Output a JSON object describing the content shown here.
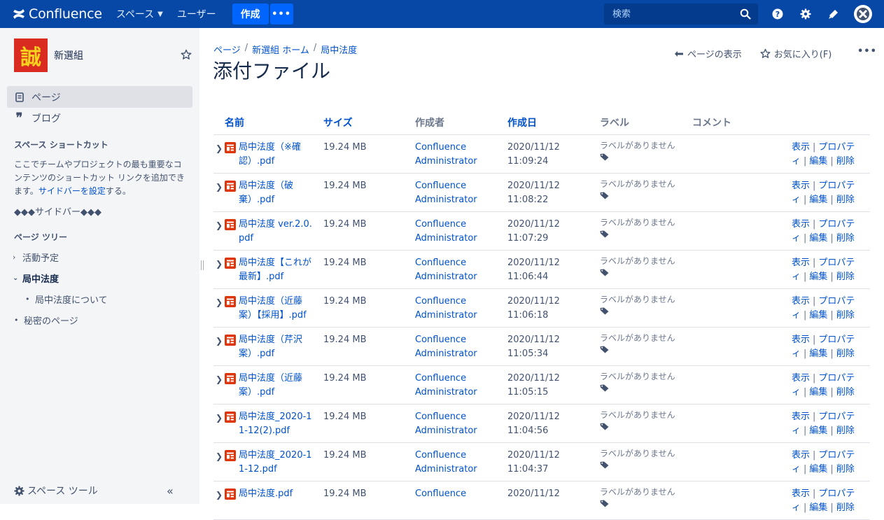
{
  "topnav": {
    "product": "Confluence",
    "spaces": "スペース",
    "users": "ユーザー",
    "create": "作成",
    "more": "•••",
    "search_placeholder": "検索"
  },
  "sidebar": {
    "space_logo_char": "誠",
    "space_name": "新選組",
    "nav": [
      {
        "label": "ページ"
      },
      {
        "label": "ブログ"
      }
    ],
    "shortcuts_heading": "スペース ショートカット",
    "shortcuts_text_before": "ここでチームやプロジェクトの最も重要なコンテンツのショートカット リンクを追加できます。",
    "shortcuts_link": "サイドバーを設定",
    "shortcuts_text_after": "する。",
    "custom_text": "◆◆◆サイドバー◆◆◆",
    "tree_heading": "ページ ツリー",
    "tree": [
      {
        "label": "活動予定"
      },
      {
        "label": "局中法度"
      },
      {
        "label": "局中法度について"
      },
      {
        "label": "秘密のページ"
      }
    ],
    "tools": "スペース ツール",
    "collapse": "«"
  },
  "breadcrumb": [
    "ページ",
    "新選組 ホーム",
    "局中法度"
  ],
  "page": {
    "title": "添付ファイル",
    "view_page": "ページの表示",
    "favourite": "お気に入り(F)",
    "more": "•••"
  },
  "table": {
    "headers": {
      "name": "名前",
      "size": "サイズ",
      "creator": "作成者",
      "date": "作成日",
      "label": "ラベル",
      "comment": "コメント"
    },
    "no_labels": "ラベルがありません",
    "action_view": "表示",
    "action_props": "プロパティ",
    "action_edit": "編集",
    "action_delete": "削除",
    "rows": [
      {
        "name": "局中法度（※確認）.pdf",
        "size": "19.24 MB",
        "creator": "Confluence Administrator",
        "date": "2020/11/12 11:09:24"
      },
      {
        "name": "局中法度（破棄）.pdf",
        "size": "19.24 MB",
        "creator": "Confluence Administrator",
        "date": "2020/11/12 11:08:22"
      },
      {
        "name": "局中法度 ver.2.0.pdf",
        "size": "19.24 MB",
        "creator": "Confluence Administrator",
        "date": "2020/11/12 11:07:29"
      },
      {
        "name": "局中法度【これが最新】.pdf",
        "size": "19.24 MB",
        "creator": "Confluence Administrator",
        "date": "2020/11/12 11:06:44"
      },
      {
        "name": "局中法度（近藤案）【採用】.pdf",
        "size": "19.24 MB",
        "creator": "Confluence Administrator",
        "date": "2020/11/12 11:06:18"
      },
      {
        "name": "局中法度（芹沢案）.pdf",
        "size": "19.24 MB",
        "creator": "Confluence Administrator",
        "date": "2020/11/12 11:05:34"
      },
      {
        "name": "局中法度（近藤案）.pdf",
        "size": "19.24 MB",
        "creator": "Confluence Administrator",
        "date": "2020/11/12 11:05:15"
      },
      {
        "name": "局中法度_2020-11-12(2).pdf",
        "size": "19.24 MB",
        "creator": "Confluence Administrator",
        "date": "2020/11/12 11:04:56"
      },
      {
        "name": "局中法度_2020-11-12.pdf",
        "size": "19.24 MB",
        "creator": "Confluence Administrator",
        "date": "2020/11/12 11:04:37"
      },
      {
        "name": "局中法度.pdf",
        "size": "19.24 MB",
        "creator": "Confluence",
        "date": "2020/11/12"
      }
    ]
  }
}
